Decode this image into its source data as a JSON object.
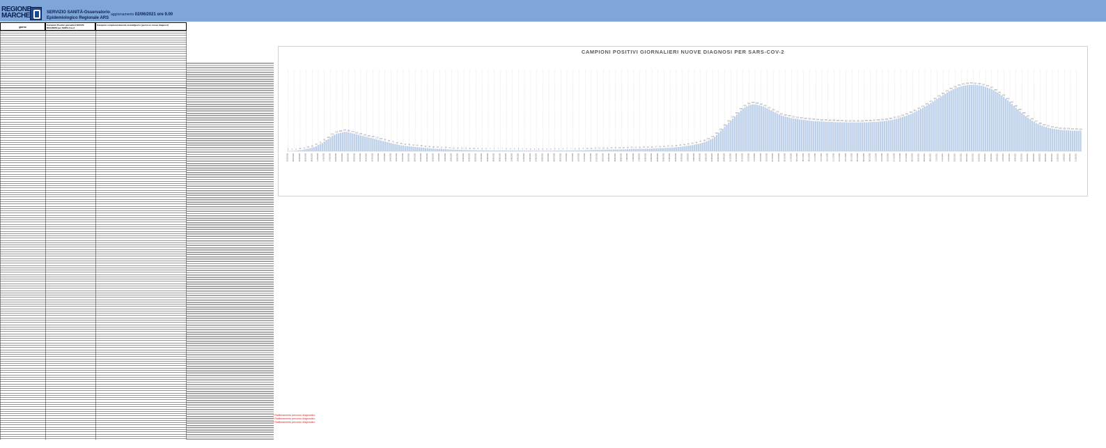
{
  "header": {
    "logo_text": "REGIONE MARCHE",
    "org_line1": "SERVIZIO SANITÀ-Osservatorio",
    "org_line2": "Epidemiologico Regionale ARS",
    "update_label": "aggiornamento",
    "update_value": "02/06/2021 ore 9.00"
  },
  "table": {
    "col_giorno": "giorno",
    "col_positivi": "Campioni Positivi giornalieri NUOVE DIAGNOSI per SARS-Cov-2",
    "col_testati": "Campioni complessivamente testati/giorno (percorso nuove diagnosi)"
  },
  "notes": {
    "red_note": "* Riallineamento percorso diagnostico"
  },
  "colors": {
    "header_band": "#7ea6d8",
    "bar_fill": "#bdd0e9",
    "grid_dash": "#d9d9d9"
  },
  "chart_data": {
    "type": "bar",
    "title": "CAMPIONI POSITIVI GIORNALIERI NUOVE DIAGNOSI PER SARS-COV-2",
    "xlabel": "",
    "ylabel": "",
    "grid": "vertical dashed",
    "legend": "none",
    "x_start": "2020-02-25",
    "x_end": "2021-06-01",
    "ylim": [
      0,
      800
    ],
    "values": [
      2,
      2,
      3,
      4,
      5,
      8,
      10,
      12,
      15,
      20,
      25,
      30,
      35,
      40,
      50,
      60,
      70,
      80,
      95,
      110,
      120,
      135,
      150,
      160,
      170,
      175,
      180,
      185,
      190,
      188,
      185,
      180,
      175,
      170,
      165,
      160,
      155,
      150,
      145,
      140,
      135,
      130,
      125,
      120,
      115,
      110,
      105,
      100,
      95,
      90,
      85,
      80,
      75,
      70,
      66,
      62,
      58,
      55,
      52,
      50,
      48,
      46,
      44,
      42,
      40,
      38,
      36,
      34,
      32,
      30,
      28,
      26,
      25,
      24,
      23,
      22,
      21,
      20,
      19,
      18,
      17,
      16,
      15,
      14,
      14,
      13,
      13,
      12,
      12,
      11,
      11,
      10,
      10,
      9,
      9,
      9,
      8,
      8,
      8,
      8,
      7,
      7,
      7,
      7,
      7,
      7,
      7,
      7,
      6,
      6,
      6,
      6,
      6,
      6,
      6,
      6,
      6,
      6,
      6,
      6,
      5,
      5,
      5,
      5,
      5,
      5,
      5,
      5,
      5,
      5,
      5,
      5,
      6,
      6,
      6,
      6,
      6,
      6,
      7,
      7,
      7,
      7,
      8,
      8,
      8,
      9,
      9,
      10,
      10,
      11,
      11,
      12,
      12,
      13,
      13,
      14,
      14,
      15,
      15,
      16,
      16,
      16,
      17,
      17,
      18,
      18,
      18,
      19,
      19,
      20,
      20,
      21,
      21,
      22,
      22,
      23,
      23,
      24,
      24,
      25,
      25,
      26,
      27,
      28,
      29,
      30,
      31,
      32,
      33,
      34,
      35,
      37,
      39,
      41,
      43,
      45,
      48,
      51,
      54,
      57,
      60,
      64,
      68,
      72,
      77,
      82,
      88,
      95,
      105,
      115,
      125,
      140,
      160,
      180,
      200,
      220,
      240,
      260,
      280,
      300,
      320,
      340,
      360,
      380,
      400,
      420,
      430,
      440,
      450,
      455,
      460,
      458,
      455,
      450,
      445,
      440,
      430,
      420,
      410,
      400,
      390,
      380,
      370,
      360,
      350,
      345,
      340,
      335,
      330,
      325,
      320,
      318,
      315,
      312,
      310,
      308,
      305,
      303,
      300,
      298,
      296,
      295,
      294,
      293,
      292,
      291,
      290,
      289,
      288,
      287,
      286,
      285,
      284,
      284,
      283,
      283,
      282,
      282,
      282,
      281,
      281,
      281,
      281,
      282,
      282,
      283,
      283,
      284,
      285,
      286,
      287,
      288,
      290,
      292,
      294,
      296,
      299,
      302,
      305,
      309,
      313,
      318,
      323,
      329,
      335,
      342,
      349,
      357,
      365,
      374,
      383,
      393,
      403,
      414,
      425,
      437,
      449,
      461,
      473,
      486,
      499,
      512,
      525,
      538,
      551,
      563,
      575,
      586,
      597,
      607,
      616,
      624,
      631,
      637,
      642,
      646,
      649,
      651,
      652,
      652,
      651,
      649,
      646,
      642,
      637,
      631,
      624,
      616,
      607,
      597,
      586,
      574,
      561,
      547,
      532,
      516,
      499,
      482,
      464,
      446,
      428,
      410,
      392,
      375,
      358,
      342,
      327,
      313,
      300,
      288,
      277,
      267,
      258,
      250,
      243,
      237,
      231,
      226,
      222,
      218,
      215,
      212,
      210,
      208,
      206,
      205,
      204,
      203,
      202,
      202,
      201,
      201,
      200
    ]
  }
}
